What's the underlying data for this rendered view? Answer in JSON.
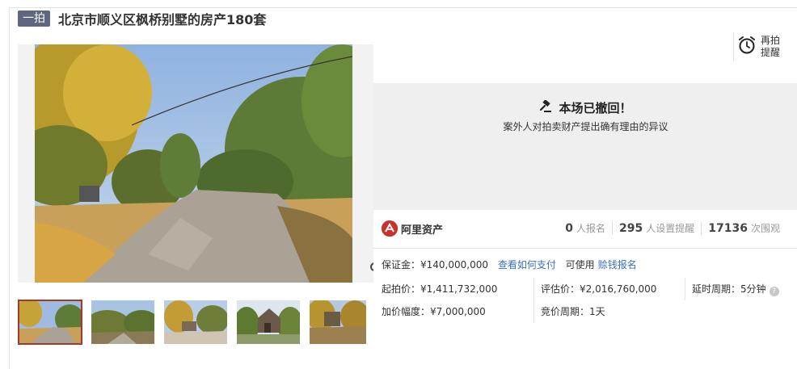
{
  "header": {
    "badge": "一拍",
    "title": "北京市顺义区枫桥别墅的房产180套"
  },
  "remind": {
    "icon": "alarm-clock-icon",
    "label": "再拍提醒"
  },
  "status": {
    "icon": "gavel-icon",
    "title": "本场已撤回！",
    "subtitle": "案外人对拍卖财产提出确有理由的异议"
  },
  "brand": {
    "name": "阿里资产"
  },
  "stats": [
    {
      "value": "0",
      "label": "人报名"
    },
    {
      "value": "295",
      "label": "人设置提醒"
    },
    {
      "value": "17136",
      "label": "次围观"
    }
  ],
  "deposit": {
    "label": "保证金：",
    "value": "¥140,000,000",
    "link": "查看如何支付",
    "usable": "可使用",
    "link2": "赊钱报名"
  },
  "details": {
    "start_price_label": "起拍价：",
    "start_price": "¥1,411,732,000",
    "increment_label": "加价幅度：",
    "increment": "¥7,000,000",
    "assessed_label": "评估价：",
    "assessed": "¥2,016,760,000",
    "cycle_label": "竞价周期：",
    "cycle": "1天",
    "delay_label": "延时周期：",
    "delay": "5分钟"
  },
  "colors": {
    "accent": "#a23a28",
    "link": "#3a6fc0",
    "badge": "#5e6680",
    "brand": "#c8322c"
  }
}
